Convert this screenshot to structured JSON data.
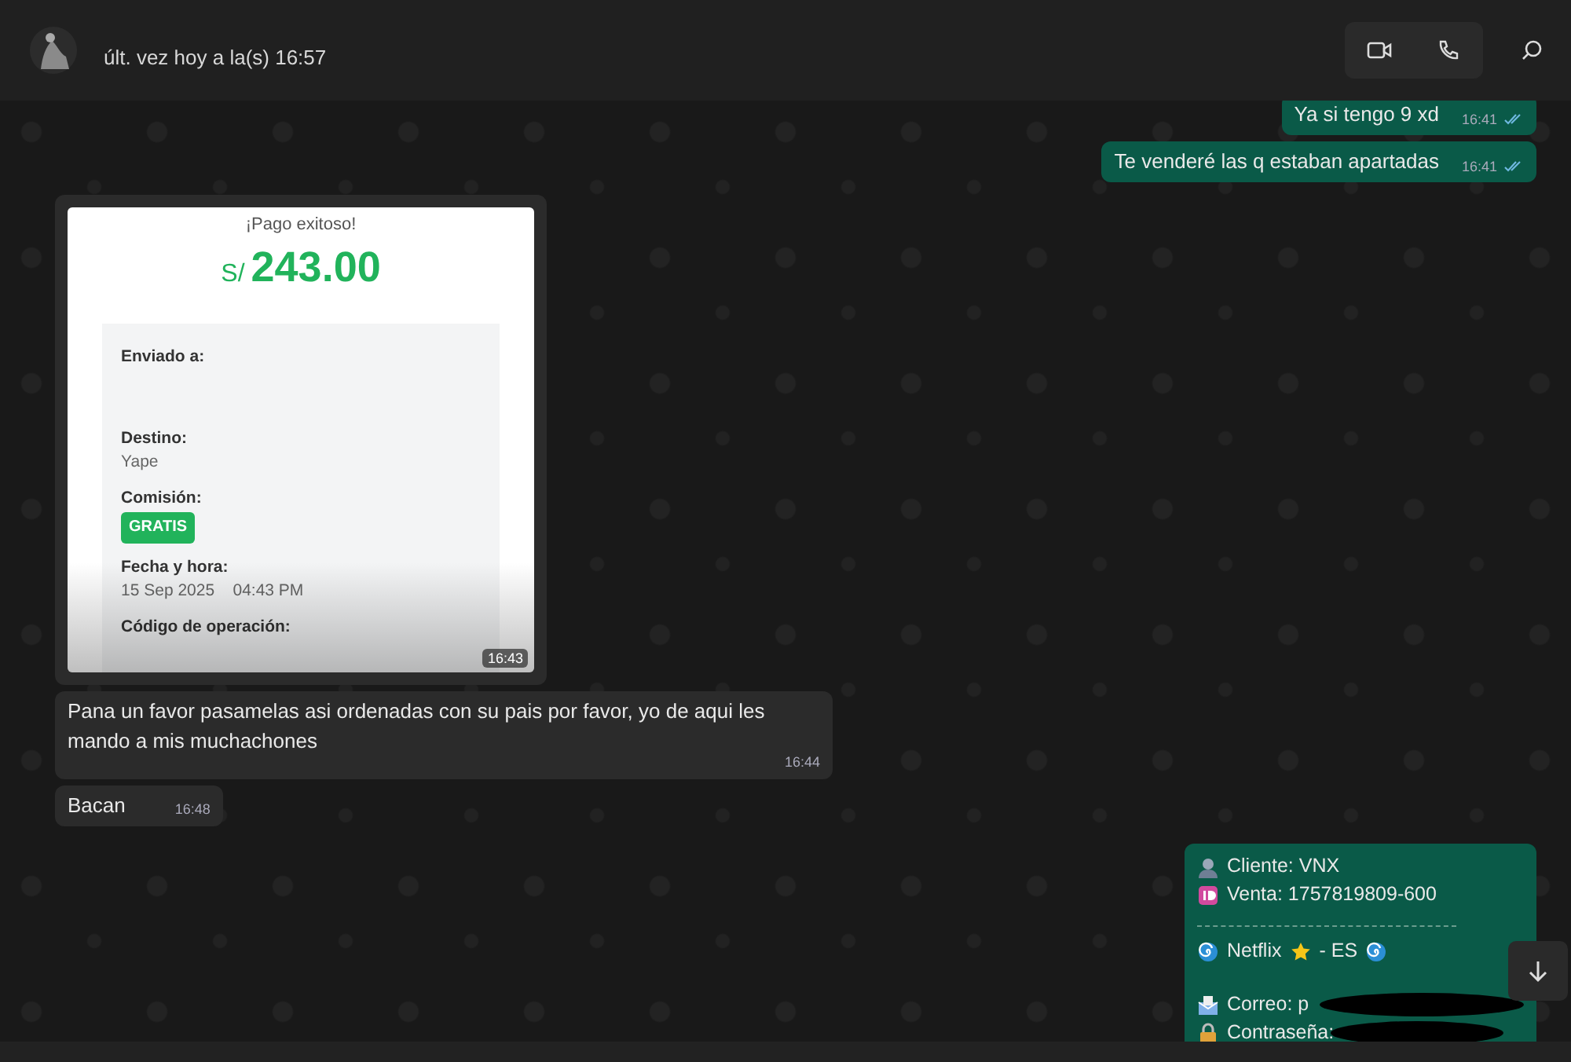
{
  "header": {
    "status": "últ. vez hoy a la(s) 16:57"
  },
  "messages": [
    {
      "kind": "text",
      "outgoing": true,
      "text": "Ya si tengo 9 xd",
      "time": "16:41",
      "read": true
    },
    {
      "kind": "text",
      "outgoing": true,
      "text": "Te venderé las q estaban apartadas",
      "time": "16:41",
      "read": true
    },
    {
      "kind": "receipt",
      "outgoing": false,
      "time": "16:43",
      "receipt": {
        "title": "¡Pago exitoso!",
        "currency": "S/",
        "amount": "243.00",
        "fields": [
          {
            "label": "Enviado a:"
          },
          {
            "label": "Destino:",
            "value": "Yape"
          },
          {
            "label": "Comisión:",
            "badge": "GRATIS"
          },
          {
            "label": "Fecha y hora:",
            "value": "15 Sep 2025    04:43 PM"
          },
          {
            "label": "Código de operación:"
          }
        ]
      }
    },
    {
      "kind": "text",
      "outgoing": false,
      "text": "Pana un favor pasamelas asi ordenadas con su pais por favor, yo de aqui les mando a mis muchachones",
      "time": "16:44"
    },
    {
      "kind": "text",
      "outgoing": false,
      "text": "Bacan",
      "time": "16:48"
    },
    {
      "kind": "card",
      "outgoing": true,
      "lines": [
        {
          "kind": "client",
          "text": "Cliente: VNX"
        },
        {
          "kind": "sale",
          "text": "Venta: 1757819809-600"
        },
        {
          "kind": "divider"
        },
        {
          "kind": "service",
          "name": "Netflix",
          "suffix": "- ES"
        },
        {
          "kind": "gap"
        },
        {
          "kind": "email",
          "text": "Correo: p",
          "redacted": true
        },
        {
          "kind": "password",
          "text": "Contraseña:",
          "redacted": true
        }
      ]
    }
  ]
}
